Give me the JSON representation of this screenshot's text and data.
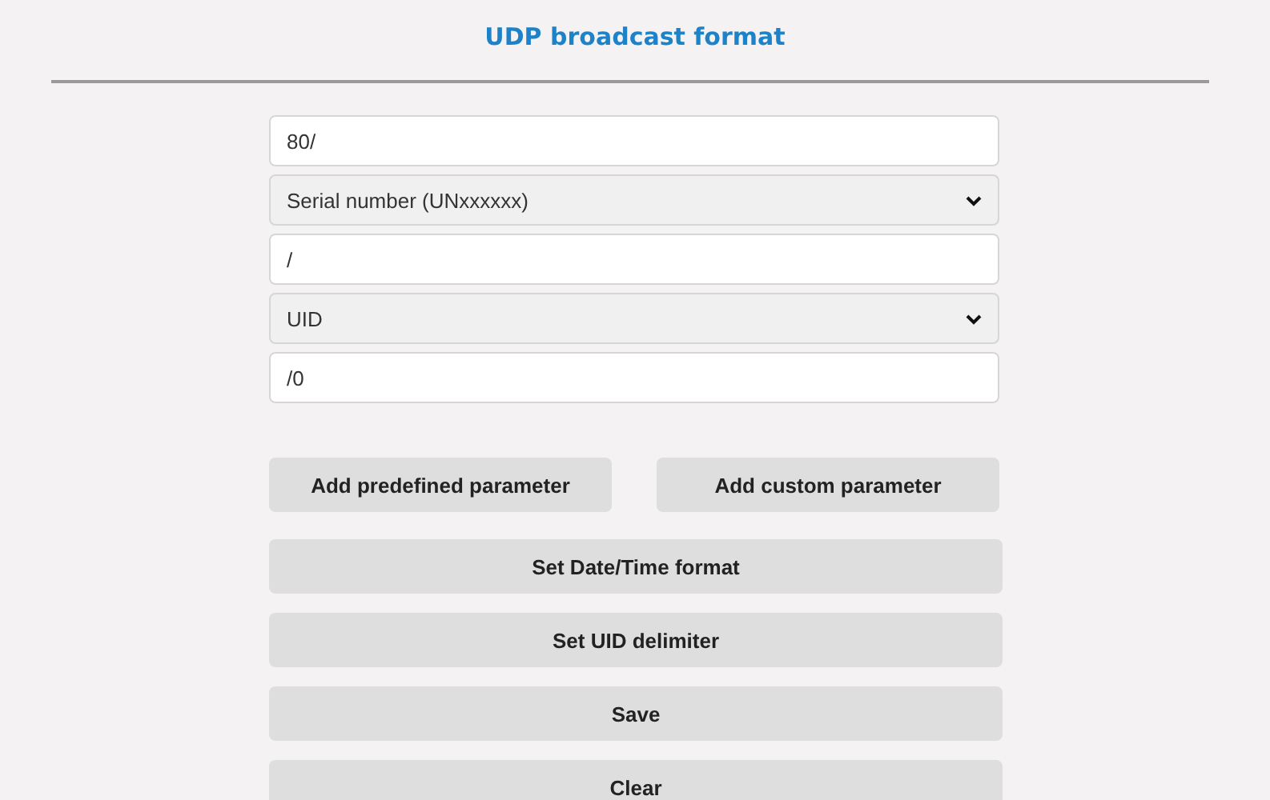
{
  "title": "UDP broadcast format",
  "fields": [
    {
      "kind": "text",
      "value": "80/"
    },
    {
      "kind": "select",
      "value": "Serial number (UNxxxxxx)"
    },
    {
      "kind": "text",
      "value": "/"
    },
    {
      "kind": "select",
      "value": "UID"
    },
    {
      "kind": "text",
      "value": "/0"
    }
  ],
  "buttons": [
    {
      "kind": "half",
      "label": "Add predefined parameter"
    },
    {
      "kind": "half",
      "label": "Add custom parameter"
    },
    {
      "kind": "full",
      "label": "Set Date/Time format"
    },
    {
      "kind": "full",
      "label": "Set UID delimiter"
    },
    {
      "kind": "full",
      "label": "Save"
    },
    {
      "kind": "full",
      "label": "Clear"
    }
  ]
}
